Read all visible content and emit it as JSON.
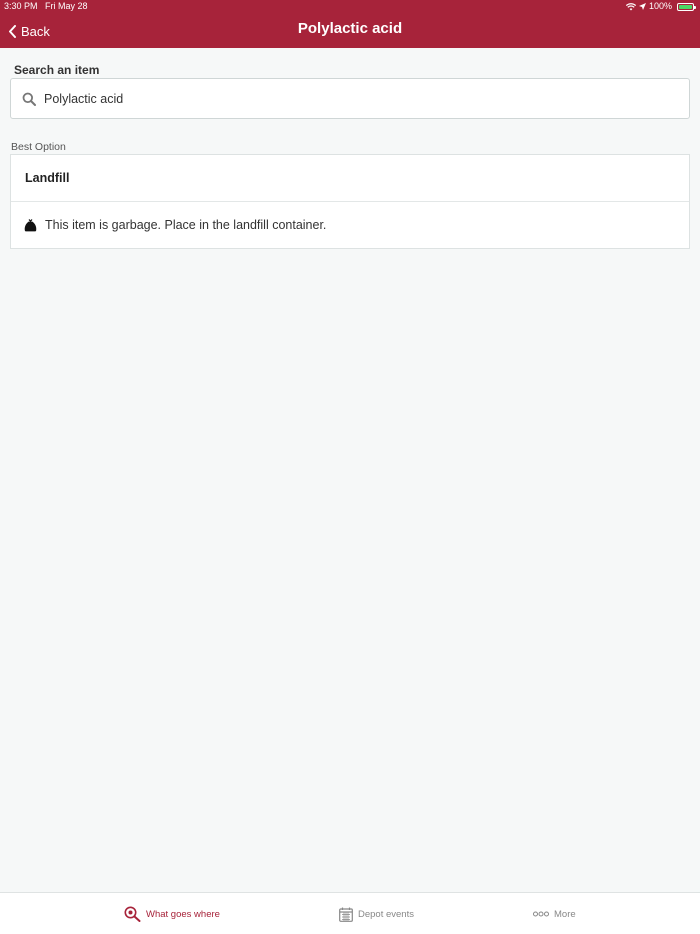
{
  "status_bar": {
    "time": "3:30 PM",
    "date": "Fri May 28",
    "battery": "100%"
  },
  "header": {
    "back_label": "Back",
    "title": "Polylactic acid",
    "background_color": "#a7233a"
  },
  "search": {
    "label": "Search an item",
    "value": "Polylactic acid",
    "placeholder": "Search an item"
  },
  "result": {
    "section_label": "Best Option",
    "title": "Landfill",
    "description": "This item is garbage. Place in the landfill container.",
    "icon": "garbage-bag-icon"
  },
  "tabbar": {
    "tabs": [
      {
        "label": "What goes where",
        "icon": "search-icon",
        "active": true
      },
      {
        "label": "Depot events",
        "icon": "calendar-icon",
        "active": false
      },
      {
        "label": "More",
        "icon": "more-dots-icon",
        "active": false
      }
    ],
    "active_color": "#a7233a",
    "inactive_color": "#888888"
  }
}
